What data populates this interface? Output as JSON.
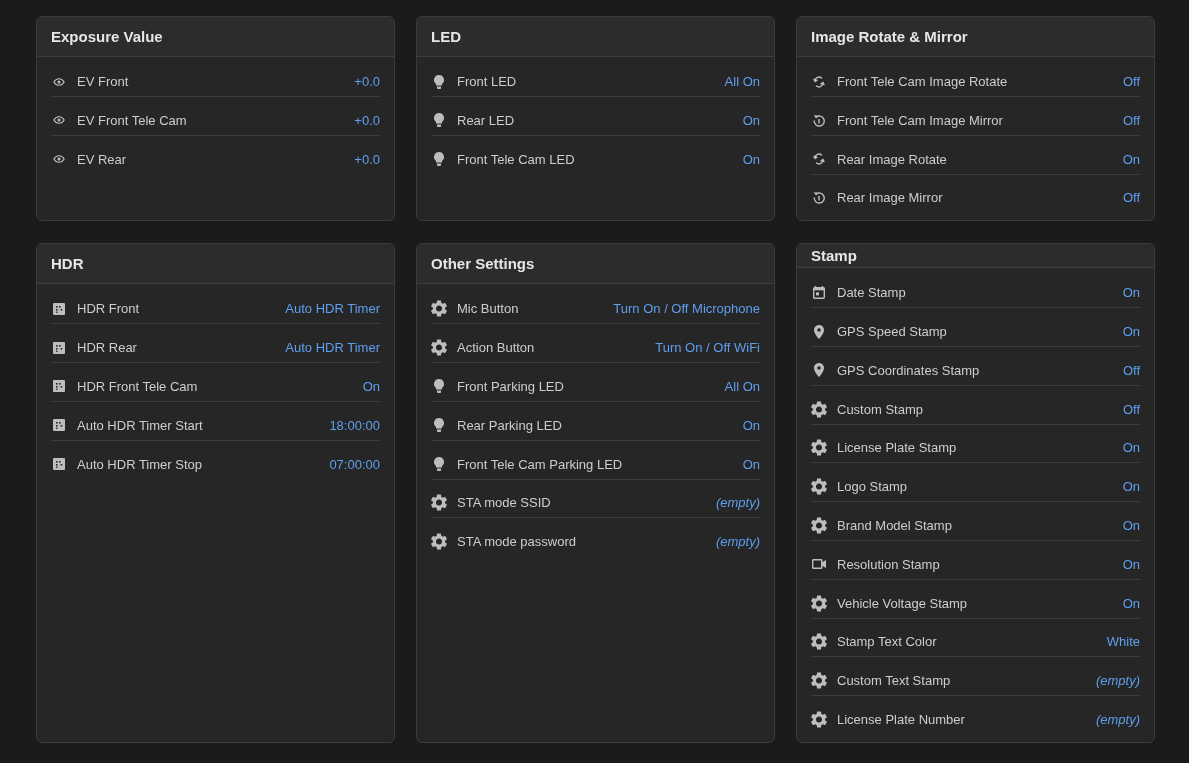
{
  "panels": [
    {
      "title": "Exposure Value",
      "rows": [
        {
          "kind": "exposure",
          "label": "EV Front",
          "value": "+0.0",
          "unset": false
        },
        {
          "kind": "exposure",
          "label": "EV Front Tele Cam",
          "value": "+0.0",
          "unset": false
        },
        {
          "kind": "exposure",
          "label": "EV Rear",
          "value": "+0.0",
          "unset": false
        }
      ]
    },
    {
      "title": "LED",
      "rows": [
        {
          "kind": "light",
          "label": "Front LED",
          "value": "All On",
          "unset": false
        },
        {
          "kind": "light",
          "label": "Rear LED",
          "value": "On",
          "unset": false
        },
        {
          "kind": "light",
          "label": "Front Tele Cam LED",
          "value": "On",
          "unset": false
        }
      ]
    },
    {
      "title": "Image Rotate & Mirror",
      "rows": [
        {
          "kind": "rotate",
          "label": "Front Tele Cam Image Rotate",
          "value": "Off",
          "unset": false
        },
        {
          "kind": "mirror",
          "label": "Front Tele Cam Image Mirror",
          "value": "Off",
          "unset": false
        },
        {
          "kind": "rotate",
          "label": "Rear Image Rotate",
          "value": "On",
          "unset": false
        },
        {
          "kind": "mirror",
          "label": "Rear Image Mirror",
          "value": "Off",
          "unset": false
        }
      ]
    },
    {
      "title": "HDR",
      "rows": [
        {
          "kind": "hdr",
          "label": "HDR Front",
          "value": "Auto HDR Timer",
          "unset": false
        },
        {
          "kind": "hdr",
          "label": "HDR Rear",
          "value": "Auto HDR Timer",
          "unset": false
        },
        {
          "kind": "hdr",
          "label": "HDR Front Tele Cam",
          "value": "On",
          "unset": false
        },
        {
          "kind": "hdr",
          "label": "Auto HDR Timer Start",
          "value": "18:00:00",
          "unset": false
        },
        {
          "kind": "hdr",
          "label": "Auto HDR Timer Stop",
          "value": "07:00:00",
          "unset": false
        }
      ]
    },
    {
      "title": "Other Settings",
      "rows": [
        {
          "kind": "general",
          "label": "Mic Button",
          "value": "Turn On / Off Microphone",
          "unset": false
        },
        {
          "kind": "general",
          "label": "Action Button",
          "value": "Turn On / Off WiFi",
          "unset": false
        },
        {
          "kind": "light",
          "label": "Front Parking LED",
          "value": "All On",
          "unset": false
        },
        {
          "kind": "light",
          "label": "Rear Parking LED",
          "value": "On",
          "unset": false
        },
        {
          "kind": "light",
          "label": "Front Tele Cam Parking LED",
          "value": "On",
          "unset": false
        },
        {
          "kind": "general",
          "label": "STA mode SSID",
          "value": "(empty)",
          "unset": true
        },
        {
          "kind": "general",
          "label": "STA mode password",
          "value": "(empty)",
          "unset": true
        }
      ]
    },
    {
      "title": "Stamp",
      "rows": [
        {
          "kind": "date",
          "label": "Date Stamp",
          "value": "On",
          "unset": false
        },
        {
          "kind": "gps",
          "label": "GPS Speed Stamp",
          "value": "On",
          "unset": false
        },
        {
          "kind": "gps",
          "label": "GPS Coordinates Stamp",
          "value": "Off",
          "unset": false
        },
        {
          "kind": "general",
          "label": "Custom Stamp",
          "value": "Off",
          "unset": false
        },
        {
          "kind": "general",
          "label": "License Plate Stamp",
          "value": "On",
          "unset": false
        },
        {
          "kind": "general",
          "label": "Logo Stamp",
          "value": "On",
          "unset": false
        },
        {
          "kind": "general",
          "label": "Brand Model Stamp",
          "value": "On",
          "unset": false
        },
        {
          "kind": "video",
          "label": "Resolution Stamp",
          "value": "On",
          "unset": false
        },
        {
          "kind": "general",
          "label": "Vehicle Voltage Stamp",
          "value": "On",
          "unset": false
        },
        {
          "kind": "general",
          "label": "Stamp Text Color",
          "value": "White",
          "unset": false
        },
        {
          "kind": "general",
          "label": "Custom Text Stamp",
          "value": "(empty)",
          "unset": true
        },
        {
          "kind": "general",
          "label": "License Plate Number",
          "value": "(empty)",
          "unset": true
        }
      ]
    }
  ]
}
